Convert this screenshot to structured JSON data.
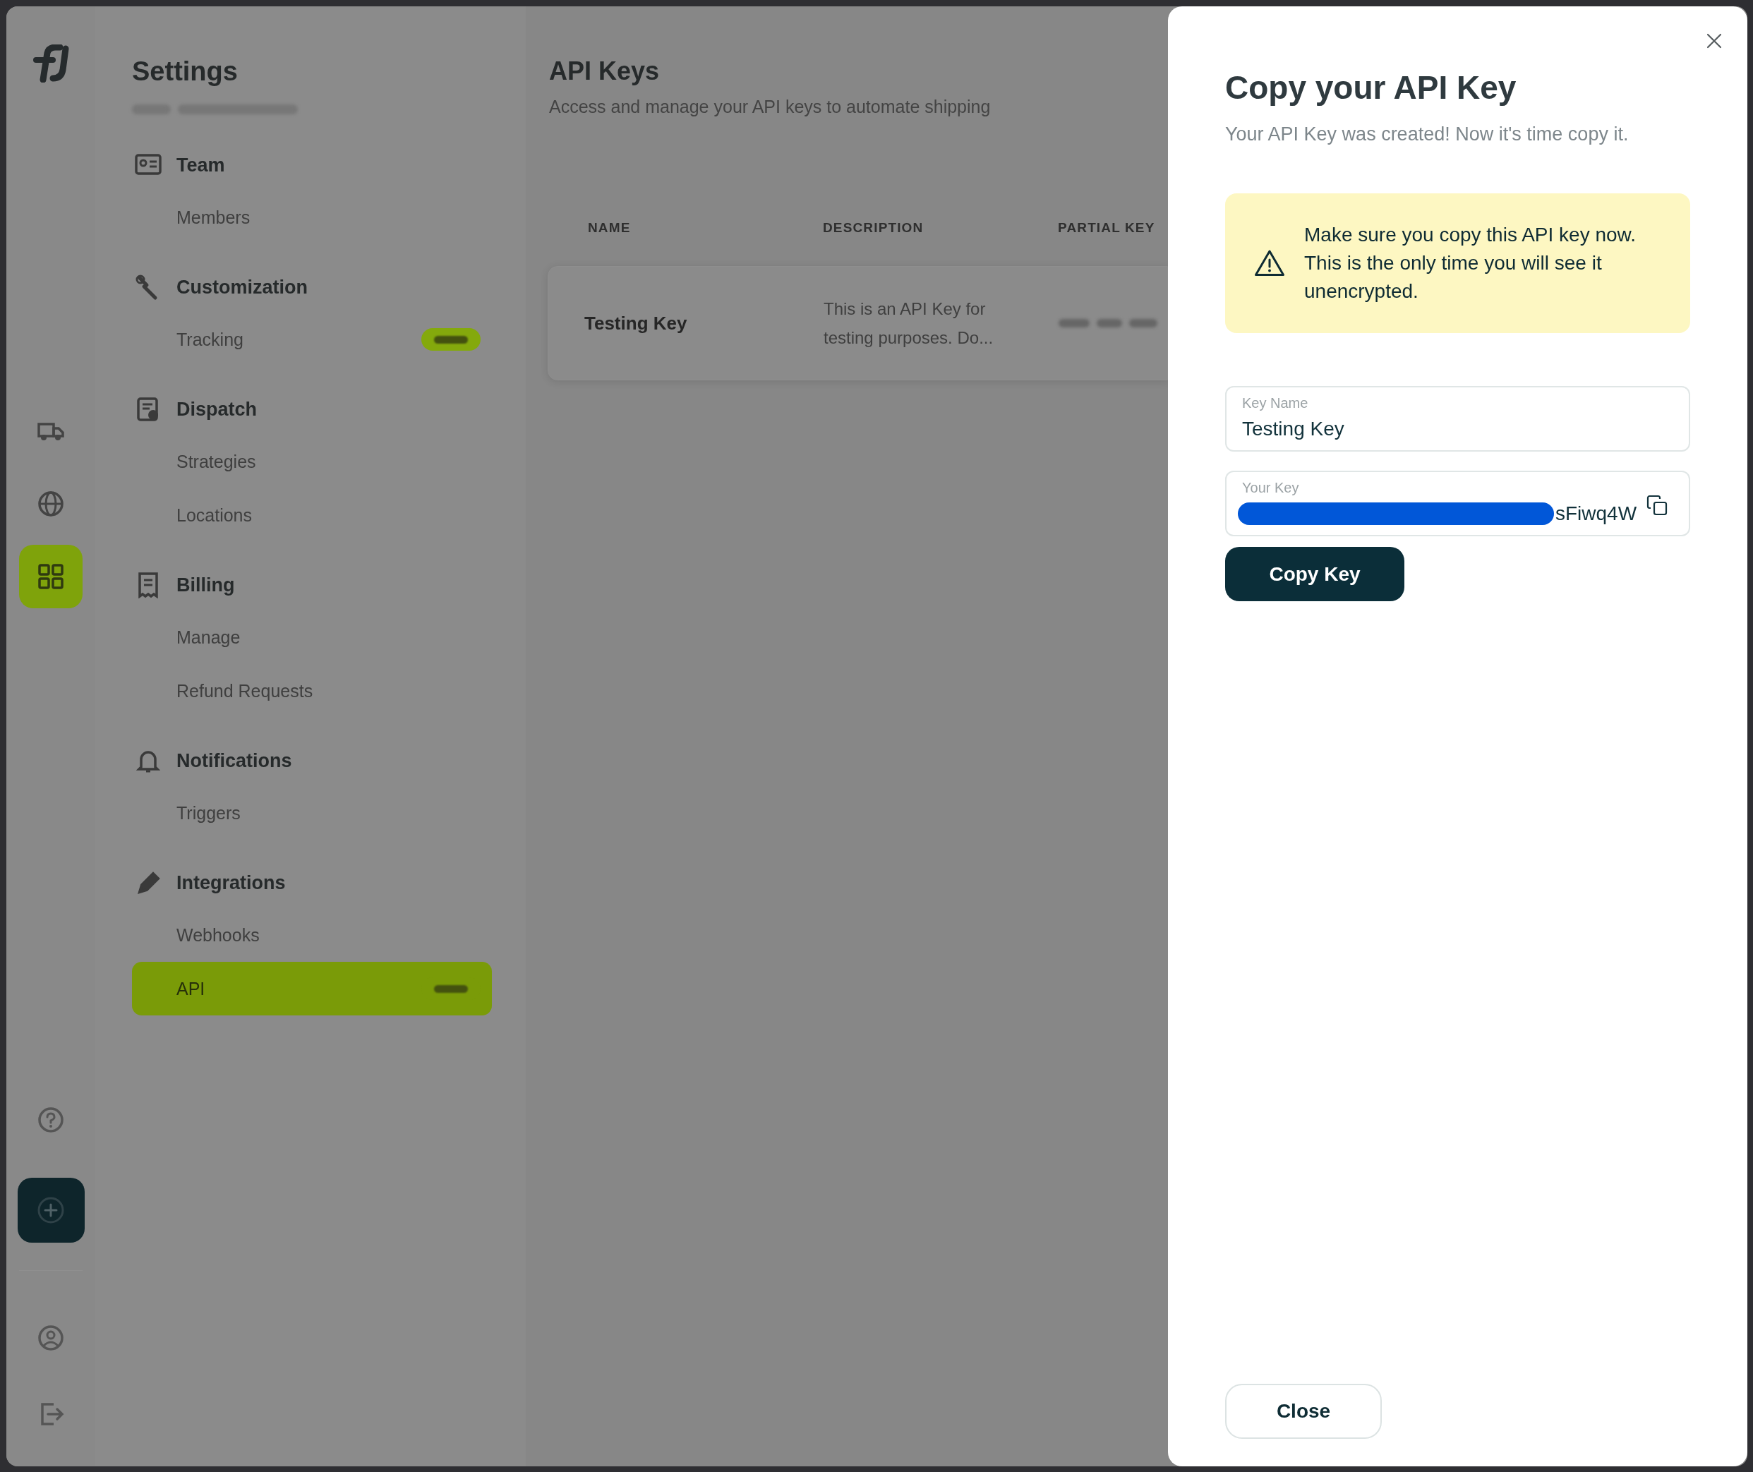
{
  "nav_rail": {
    "items": [
      {
        "selected": false
      },
      {
        "selected": false
      },
      {
        "selected": true
      }
    ]
  },
  "sidebar": {
    "title": "Settings",
    "sections": [
      {
        "label": "Team",
        "children": [
          {
            "label": "Members",
            "selected": false,
            "badge": false
          }
        ]
      },
      {
        "label": "Customization",
        "children": [
          {
            "label": "Tracking",
            "selected": false,
            "badge": true
          }
        ]
      },
      {
        "label": "Dispatch",
        "children": [
          {
            "label": "Strategies",
            "selected": false,
            "badge": false
          },
          {
            "label": "Locations",
            "selected": false,
            "badge": false
          }
        ]
      },
      {
        "label": "Billing",
        "children": [
          {
            "label": "Manage",
            "selected": false,
            "badge": false
          },
          {
            "label": "Refund Requests",
            "selected": false,
            "badge": false
          }
        ]
      },
      {
        "label": "Notifications",
        "children": [
          {
            "label": "Triggers",
            "selected": false,
            "badge": false
          }
        ]
      },
      {
        "label": "Integrations",
        "children": [
          {
            "label": "Webhooks",
            "selected": false,
            "badge": false
          },
          {
            "label": "API",
            "selected": true,
            "badge": true
          }
        ]
      }
    ]
  },
  "page": {
    "title": "API Keys",
    "subtitle": "Access and manage your API keys to automate shipping"
  },
  "table": {
    "columns": [
      "NAME",
      "DESCRIPTION",
      "PARTIAL KEY"
    ],
    "rows": [
      {
        "name": "Testing Key",
        "description": "This is an API Key for testing purposes. Do..."
      }
    ]
  },
  "modal": {
    "title": "Copy your API Key",
    "subtitle": "Your API Key was created! Now it's time copy it.",
    "warning": "Make sure you copy this API key now. This is the only time you will see it unencrypted.",
    "fields": [
      {
        "kind": "text",
        "label": "Key Name",
        "value": "Testing Key"
      },
      {
        "kind": "secret",
        "label": "Your Key",
        "value": "sFiwq4W",
        "redacted": true
      }
    ],
    "primary_button": "Copy Key",
    "close_button": "Close"
  }
}
